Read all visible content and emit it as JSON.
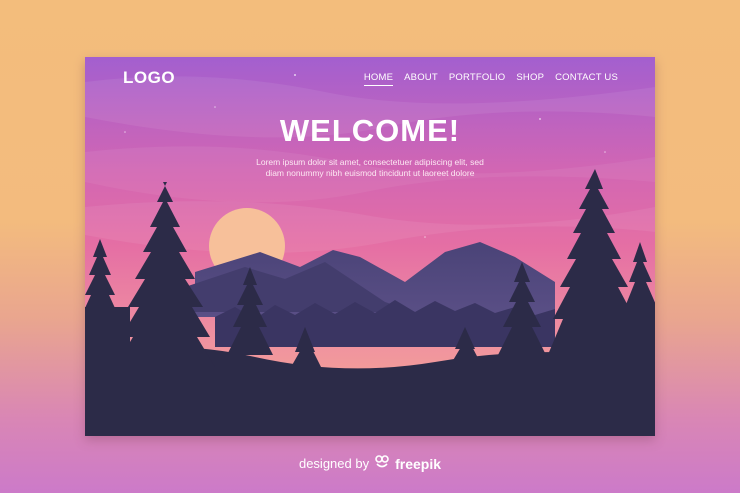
{
  "brand": {
    "logo": "LOGO"
  },
  "nav": {
    "items": [
      {
        "label": "HOME",
        "active": true
      },
      {
        "label": "ABOUT",
        "active": false
      },
      {
        "label": "PORTFOLIO",
        "active": false
      },
      {
        "label": "SHOP",
        "active": false
      },
      {
        "label": "CONTACT US",
        "active": false
      }
    ]
  },
  "hero": {
    "title": "WELCOME!",
    "text_line1": "Lorem ipsum dolor sit amet, consectetuer adipiscing elit, sed",
    "text_line2": "diam nonummy nibh euismod tincidunt ut laoreet dolore"
  },
  "footer": {
    "designed_by": "designed by",
    "brand": "freepik",
    "icon": "freepik-icon"
  },
  "colors": {
    "sky_top": "#a35fcf",
    "sky_mid": "#e56fa4",
    "sky_bottom": "#f6a88a",
    "mountain": "#4e4677",
    "trees": "#2c2b48"
  }
}
